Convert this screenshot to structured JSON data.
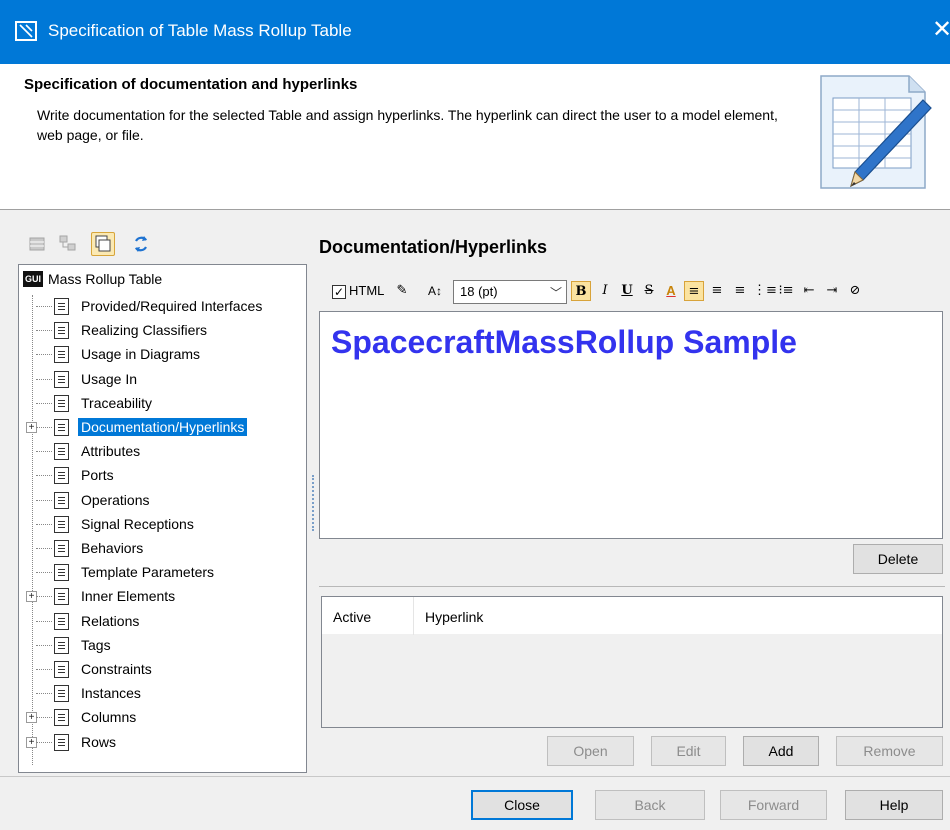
{
  "window": {
    "title": "Specification of Table Mass Rollup Table",
    "close_glyph": "✕"
  },
  "header": {
    "title": "Specification of documentation and hyperlinks",
    "description": "Write documentation for the selected Table and assign hyperlinks. The hyperlink can direct the user to a model element, web page, or file."
  },
  "tree": {
    "root_badge": "GUI",
    "root_label": "Mass Rollup Table",
    "items": [
      {
        "label": "Provided/Required Interfaces",
        "expandable": false,
        "selected": false
      },
      {
        "label": "Realizing Classifiers",
        "expandable": false,
        "selected": false
      },
      {
        "label": "Usage in Diagrams",
        "expandable": false,
        "selected": false
      },
      {
        "label": "Usage In",
        "expandable": false,
        "selected": false
      },
      {
        "label": "Traceability",
        "expandable": false,
        "selected": false
      },
      {
        "label": "Documentation/Hyperlinks",
        "expandable": true,
        "selected": true
      },
      {
        "label": "Attributes",
        "expandable": false,
        "selected": false
      },
      {
        "label": "Ports",
        "expandable": false,
        "selected": false
      },
      {
        "label": "Operations",
        "expandable": false,
        "selected": false
      },
      {
        "label": "Signal Receptions",
        "expandable": false,
        "selected": false
      },
      {
        "label": "Behaviors",
        "expandable": false,
        "selected": false
      },
      {
        "label": "Template Parameters",
        "expandable": false,
        "selected": false
      },
      {
        "label": "Inner Elements",
        "expandable": true,
        "selected": false
      },
      {
        "label": "Relations",
        "expandable": false,
        "selected": false
      },
      {
        "label": "Tags",
        "expandable": false,
        "selected": false
      },
      {
        "label": "Constraints",
        "expandable": false,
        "selected": false
      },
      {
        "label": "Instances",
        "expandable": false,
        "selected": false
      },
      {
        "label": "Columns",
        "expandable": true,
        "selected": false
      },
      {
        "label": "Rows",
        "expandable": true,
        "selected": false
      }
    ]
  },
  "section": {
    "title": "Documentation/Hyperlinks"
  },
  "editor": {
    "html_checked": true,
    "html_label": "HTML",
    "font_size": "18 (pt)",
    "content": "SpacecraftMassRollup Sample",
    "content_color": "#3333ee"
  },
  "buttons": {
    "delete": "Delete",
    "open": "Open",
    "edit": "Edit",
    "add": "Add",
    "remove": "Remove",
    "close": "Close",
    "back": "Back",
    "forward": "Forward",
    "help": "Help"
  },
  "hyperlinks": {
    "columns": [
      "Active",
      "Hyperlink"
    ],
    "rows": []
  },
  "colors": {
    "titlebar": "#0078d7",
    "selection": "#0078d7",
    "editor_text": "#3333ee"
  }
}
